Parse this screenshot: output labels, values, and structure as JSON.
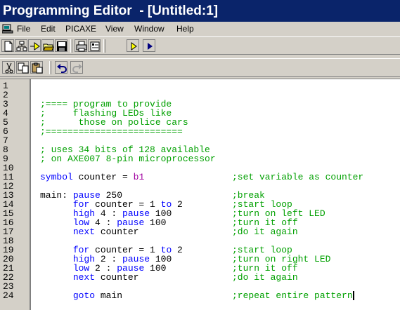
{
  "window": {
    "title": "Programming Editor  - [Untitled:1]"
  },
  "menu": [
    "File",
    "Edit",
    "PICAXE",
    "View",
    "Window",
    "Help"
  ],
  "toolbar1": [
    "new-file-icon",
    "explorer-icon",
    "program-icon",
    "open-icon",
    "save-icon",
    "print-icon",
    "options-icon",
    "run-icon",
    "step-icon"
  ],
  "toolbar2": [
    "cut-icon",
    "copy-icon",
    "paste-icon",
    "undo-icon",
    "redo-icon"
  ],
  "editor": {
    "line_numbers": [
      "1",
      "2",
      "3",
      "4",
      "5",
      "6",
      "7",
      "8",
      "9",
      "10",
      "11",
      "12",
      "13",
      "14",
      "15",
      "16",
      "17",
      "18",
      "19",
      "20",
      "21",
      "22",
      "23",
      "24"
    ],
    "lines": [
      {
        "n": "1"
      },
      {
        "n": "2"
      },
      {
        "n": "3",
        "cmt": ";==== program to provide"
      },
      {
        "n": "4",
        "cmt": ";     flashing LEDs like"
      },
      {
        "n": "5",
        "cmt": ";      those on police cars"
      },
      {
        "n": "6",
        "cmt": ";========================="
      },
      {
        "n": "7",
        "cmt": ""
      },
      {
        "n": "8",
        "cmt": "; uses 34 bits of 128 available"
      },
      {
        "n": "9",
        "cmt": "; on AXE007 8-pin microprocessor"
      },
      {
        "n": "10"
      },
      {
        "n": "11",
        "kw": "symbol",
        "t1": " counter = ",
        "reg": "b1",
        "ocmt": ";set variable as counter"
      },
      {
        "n": "12"
      },
      {
        "n": "13",
        "t0": "main: ",
        "kw": "pause",
        "t1": " 250",
        "ocmt": ";break"
      },
      {
        "n": "14",
        "ind": "      ",
        "kw": "for",
        "t1": " counter = 1 ",
        "kw2": "to",
        "t2": " 2",
        "ocmt": ";start loop"
      },
      {
        "n": "15",
        "ind": "      ",
        "kw": "high",
        "t1": " 4 : ",
        "kw2": "pause",
        "t2": " 100",
        "ocmt": ";turn on left LED"
      },
      {
        "n": "16",
        "ind": "      ",
        "kw": "low",
        "t1": " 4 : ",
        "kw2": "pause",
        "t2": " 100",
        "ocmt": ";turn it off"
      },
      {
        "n": "17",
        "ind": "      ",
        "kw": "next",
        "t1": " counter",
        "ocmt": ";do it again"
      },
      {
        "n": "18"
      },
      {
        "n": "19",
        "ind": "      ",
        "kw": "for",
        "t1": " counter = 1 ",
        "kw2": "to",
        "t2": " 2",
        "ocmt": ";start loop"
      },
      {
        "n": "20",
        "ind": "      ",
        "kw": "high",
        "t1": " 2 : ",
        "kw2": "pause",
        "t2": " 100",
        "ocmt": ";turn on right LED"
      },
      {
        "n": "21",
        "ind": "      ",
        "kw": "low",
        "t1": " 2 : ",
        "kw2": "pause",
        "t2": " 100",
        "ocmt": ";turn it off"
      },
      {
        "n": "22",
        "ind": "      ",
        "kw": "next",
        "t1": " counter",
        "ocmt": ";do it again"
      },
      {
        "n": "23"
      },
      {
        "n": "24",
        "ind": "      ",
        "kw": "goto",
        "t1": " main",
        "ocmt": ";repeat entire pattern",
        "caret": true
      }
    ]
  },
  "colors": {
    "keyword": "#0000ff",
    "comment": "#00a000",
    "register": "#a000a0",
    "titlebar": "#0a246a"
  }
}
